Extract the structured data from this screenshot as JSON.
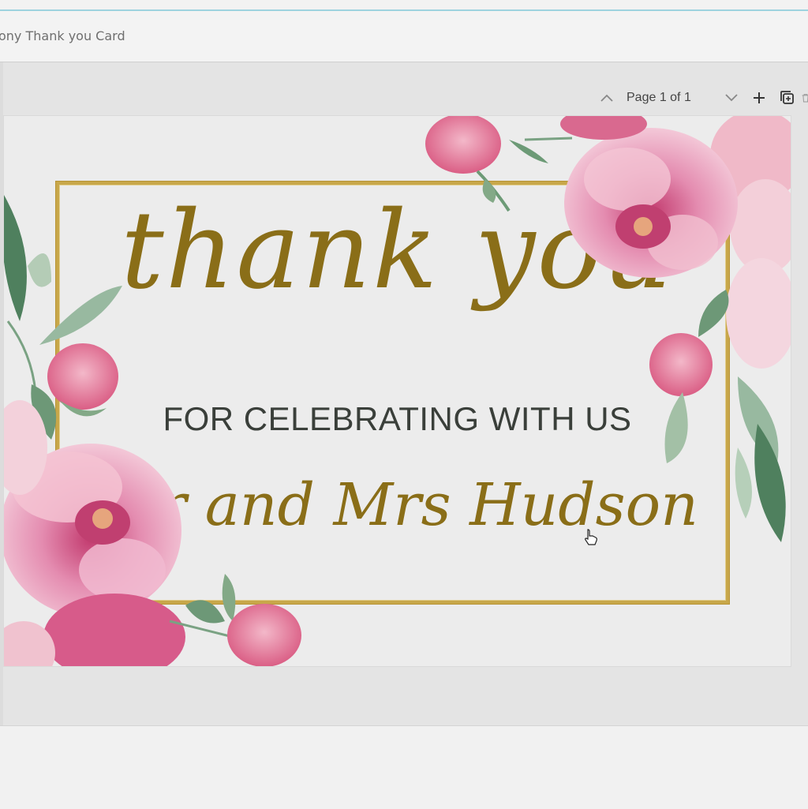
{
  "window": {
    "doc_title": "ony Thank you Card"
  },
  "page_toolbar": {
    "page_label": "Page 1 of 1",
    "icons": [
      "chevron-up-icon",
      "chevron-down-icon",
      "plus-icon",
      "duplicate-icon",
      "trash-icon"
    ]
  },
  "card": {
    "thank_you": "thank you",
    "celebrating": "FOR CELEBRATING WITH US",
    "names": "Mr and Mrs Hudson"
  },
  "colors": {
    "gold": "#8a6e18",
    "frame_gold": "#c8a74a",
    "text_dark": "#3a3f3a",
    "peony_pink": "#e58fb0",
    "leaf_green": "#5e8c6a",
    "accent_line": "#9ed3df"
  }
}
